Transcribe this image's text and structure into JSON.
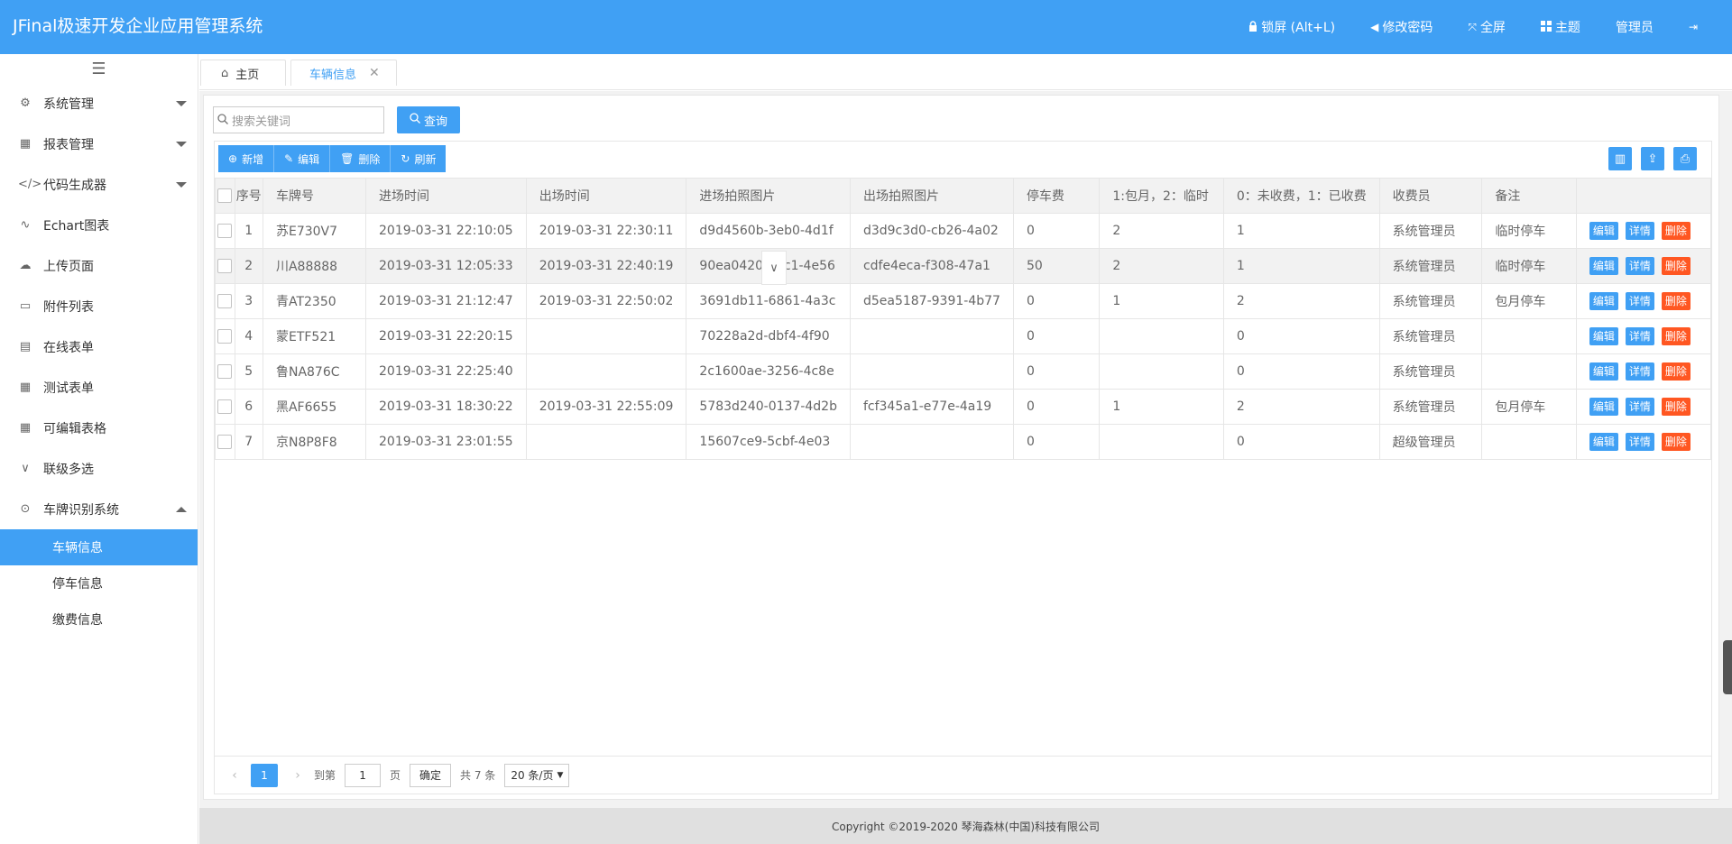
{
  "app": {
    "title": "JFinal极速开发企业应用管理系统"
  },
  "header": {
    "lock": "锁屏 (Alt+L)",
    "change_password": "修改密码",
    "fullscreen": "全屏",
    "theme": "主题",
    "user": "管理员"
  },
  "sidebar": {
    "items": [
      {
        "label": "系统管理",
        "icon": "gear-icon"
      },
      {
        "label": "报表管理",
        "icon": "report-icon"
      },
      {
        "label": "代码生成器",
        "icon": "code-icon"
      },
      {
        "label": "Echart图表",
        "icon": "chart-icon"
      },
      {
        "label": "上传页面",
        "icon": "upload-icon"
      },
      {
        "label": "附件列表",
        "icon": "attachment-icon"
      },
      {
        "label": "在线表单",
        "icon": "form-icon"
      },
      {
        "label": "测试表单",
        "icon": "table-icon"
      },
      {
        "label": "可编辑表格",
        "icon": "table-icon"
      },
      {
        "label": "联级多选",
        "icon": "chevron-icon"
      },
      {
        "label": "车牌识别系统",
        "icon": "target-icon"
      }
    ],
    "sub_items": [
      "车辆信息",
      "停车信息",
      "缴费信息"
    ],
    "active_sub": "车辆信息"
  },
  "tabs": {
    "home": "主页",
    "current": "车辆信息"
  },
  "search": {
    "placeholder": "搜索关键词",
    "button": "查询"
  },
  "toolbar": {
    "add": "新增",
    "edit": "编辑",
    "delete": "删除",
    "refresh": "刷新"
  },
  "table": {
    "columns": [
      "序号",
      "车牌号",
      "进场时间",
      "出场时间",
      "进场拍照图片",
      "出场拍照图片",
      "停车费",
      "1:包月，2：临时",
      "0：未收费，1：已收费",
      "收费员",
      "备注"
    ],
    "rows": [
      [
        "1",
        "苏E730V7",
        "2019-03-31 22:10:05",
        "2019-03-31 22:30:11",
        "d9d4560b-3eb0-4d1f",
        "d3d9c3d0-cb26-4a02",
        "0",
        "2",
        "1",
        "系统管理员",
        "临时停车"
      ],
      [
        "2",
        "川A88888",
        "2019-03-31 12:05:33",
        "2019-03-31 22:40:19",
        "90ea0420-8bc1-4e56",
        "cdfe4eca-f308-47a1",
        "50",
        "2",
        "1",
        "系统管理员",
        "临时停车"
      ],
      [
        "3",
        "青AT2350",
        "2019-03-31 21:12:47",
        "2019-03-31 22:50:02",
        "3691db11-6861-4a3c",
        "d5ea5187-9391-4b77",
        "0",
        "1",
        "2",
        "系统管理员",
        "包月停车"
      ],
      [
        "4",
        "蒙ETF521",
        "2019-03-31 22:20:15",
        "",
        "70228a2d-dbf4-4f90",
        "",
        "0",
        "",
        "0",
        "系统管理员",
        ""
      ],
      [
        "5",
        "鲁NA876C",
        "2019-03-31 22:25:40",
        "",
        "2c1600ae-3256-4c8e",
        "",
        "0",
        "",
        "0",
        "系统管理员",
        ""
      ],
      [
        "6",
        "黑AF6655",
        "2019-03-31 18:30:22",
        "2019-03-31 22:55:09",
        "5783d240-0137-4d2b",
        "fcf345a1-e77e-4a19",
        "0",
        "1",
        "2",
        "系统管理员",
        "包月停车"
      ],
      [
        "7",
        "京N8P8F8",
        "2019-03-31 23:01:55",
        "",
        "15607ce9-5cbf-4e03",
        "",
        "0",
        "",
        "0",
        "超级管理员",
        ""
      ]
    ],
    "actions": {
      "edit": "编辑",
      "detail": "详情",
      "delete": "删除"
    }
  },
  "pager": {
    "current": "1",
    "goto_label": "到第",
    "goto_value": "1",
    "page_suffix": "页",
    "confirm": "确定",
    "total": "共 7 条",
    "page_size": "20 条/页"
  },
  "footer": {
    "copyright": "Copyright ©2019-2020 琴海森林(中国)科技有限公司"
  },
  "colors": {
    "primary": "#40a0f4",
    "danger": "#ff5722",
    "header_bg": "#40a0f4"
  }
}
